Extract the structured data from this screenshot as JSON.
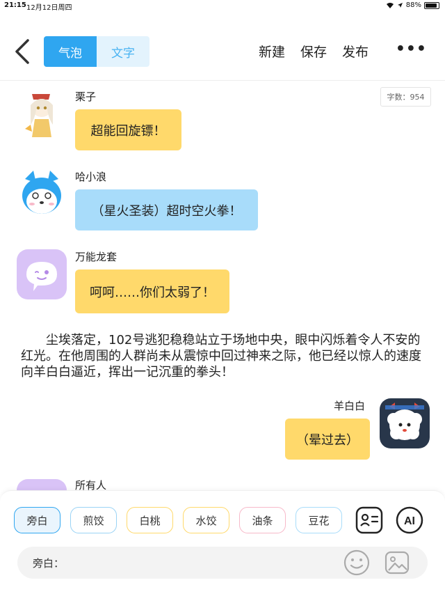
{
  "status_bar": {
    "time": "21:15",
    "date": "12月12日周四",
    "battery": "88%"
  },
  "toolbar": {
    "mode_tabs": [
      "气泡",
      "文字"
    ],
    "active_tab": "气泡",
    "new_label": "新建",
    "save_label": "保存",
    "publish_label": "发布",
    "more_label": "•••"
  },
  "word_count": "字数：954",
  "messages": [
    {
      "name": "栗子",
      "text": "超能回旋镖！",
      "bubble_color": "#ffd96b"
    },
    {
      "name": "哈小浪",
      "text": "（星火圣装）超时空火拳！",
      "bubble_color": "#a8dcfa"
    },
    {
      "name": "万能龙套",
      "text": "呵呵……你们太弱了！",
      "bubble_color": "#ffd96b"
    }
  ],
  "narration": "尘埃落定，102号逃犯稳稳站立于场地中央，眼中闪烁着令人不安的红光。在他周围的人群尚未从震惊中回过神来之际，他已经以惊人的速度向羊白白逼近，挥出一记沉重的拳头！",
  "right_message": {
    "name": "羊白白",
    "text": "（晕过去）",
    "bubble_color": "#ffd96b"
  },
  "partial_message": {
    "name": "所有人"
  },
  "role_chips": [
    {
      "label": "旁白",
      "color": "#2fa6f0"
    },
    {
      "label": "煎饺",
      "color": "#9ad3f5"
    },
    {
      "label": "白桃",
      "color": "#ffd96b"
    },
    {
      "label": "水饺",
      "color": "#ffd96b"
    },
    {
      "label": "油条",
      "color": "#f7b9c9"
    },
    {
      "label": "豆花",
      "color": "#a8dcfa"
    }
  ],
  "input": {
    "label": "旁白：",
    "placeholder": ""
  },
  "colors": {
    "accent": "#2fa6f0",
    "yellow_bubble": "#ffd96b",
    "blue_bubble": "#a8dcfa"
  }
}
